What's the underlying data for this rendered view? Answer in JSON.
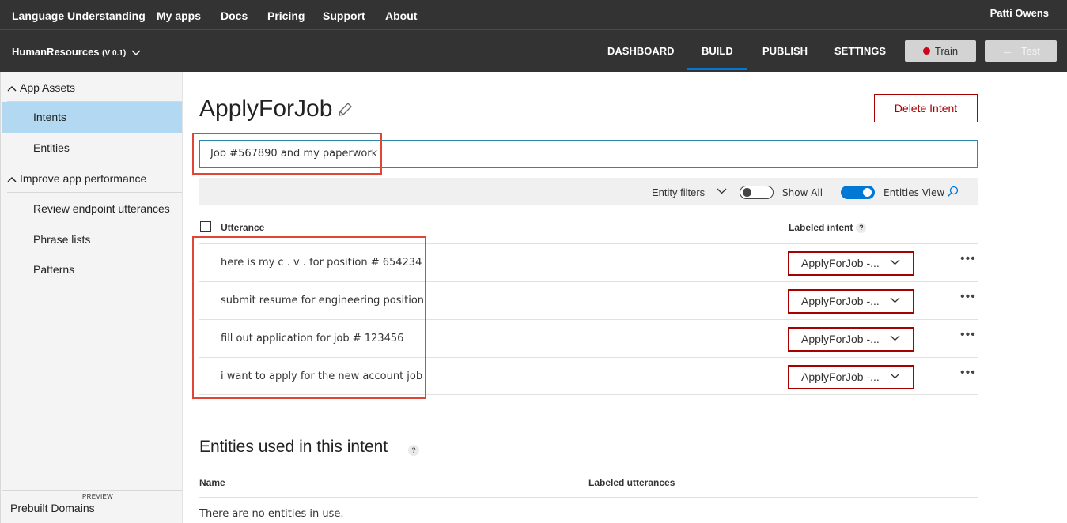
{
  "topnav": {
    "brand": "Language Understanding",
    "items": [
      "My apps",
      "Docs",
      "Pricing",
      "Support",
      "About"
    ],
    "user": "Patti Owens"
  },
  "appbar": {
    "app_name": "HumanResources",
    "version": "(V 0.1)",
    "tabs": [
      "DASHBOARD",
      "BUILD",
      "PUBLISH",
      "SETTINGS"
    ],
    "active_tab": "BUILD",
    "train_label": "Train",
    "test_label": "Test"
  },
  "sidebar": {
    "sections": [
      {
        "label": "App Assets",
        "items": [
          "Intents",
          "Entities"
        ]
      },
      {
        "label": "Improve app performance",
        "items": [
          "Review endpoint utterances",
          "Phrase lists",
          "Patterns"
        ]
      }
    ],
    "active_item": "Intents",
    "prebuilt_label": "Prebuilt Domains",
    "prebuilt_badge": "PREVIEW"
  },
  "main": {
    "title": "ApplyForJob",
    "delete_label": "Delete Intent",
    "input_value": "Job #567890 and my paperwork",
    "filters": {
      "entity_filters": "Entity filters",
      "show_all": "Show All",
      "show_all_on": false,
      "entities_view": "Entities View",
      "entities_view_on": true
    },
    "table": {
      "col_utterance": "Utterance",
      "col_intent": "Labeled intent",
      "col_intent_help": "?",
      "rows": [
        {
          "utterance": "here is my c . v . for position # 654234",
          "intent": "ApplyForJob -..."
        },
        {
          "utterance": "submit resume for engineering position",
          "intent": "ApplyForJob -..."
        },
        {
          "utterance": "fill out application for job # 123456",
          "intent": "ApplyForJob -..."
        },
        {
          "utterance": "i want to apply for the new account job",
          "intent": "ApplyForJob -..."
        }
      ]
    },
    "entities": {
      "title": "Entities used in this intent",
      "help": "?",
      "col_name": "Name",
      "col_labeled": "Labeled utterances",
      "empty_text": "There are no entities in use."
    }
  },
  "colors": {
    "header_bg": "#333333",
    "accent": "#0078d4",
    "danger": "#a80000",
    "highlight_box": "#e04535",
    "active_sidebar": "#b3d9f2"
  }
}
